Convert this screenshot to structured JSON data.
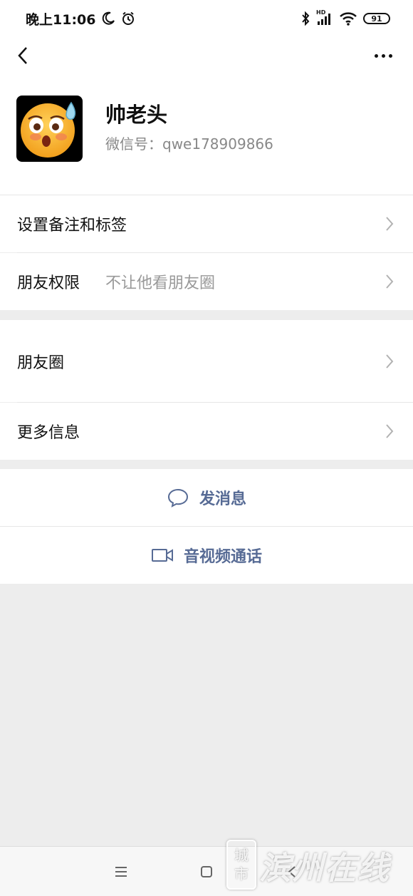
{
  "status_bar": {
    "time": "晚上11:06",
    "moon_icon": "moon-icon",
    "alarm_icon": "alarm-icon",
    "bluetooth_icon": "bluetooth-icon",
    "hd_label": "HD",
    "signal_icon": "signal-icon",
    "wifi_icon": "wifi-icon",
    "battery": "91"
  },
  "nav": {
    "back_icon": "chevron-left-icon",
    "more_icon": "more-horizontal-icon"
  },
  "profile": {
    "name": "帅老头",
    "wechat_id": "微信号：qwe178909866",
    "avatar": "sweat-emoji-avatar"
  },
  "settings": [
    {
      "label": "设置备注和标签",
      "value": ""
    },
    {
      "label": "朋友权限",
      "value": "不让他看朋友圈"
    },
    {
      "label": "朋友圈",
      "value": ""
    },
    {
      "label": "更多信息",
      "value": ""
    }
  ],
  "actions": {
    "message_label": "发消息",
    "call_label": "音视频通话"
  },
  "bottom_nav": {
    "menu_icon": "menu-icon",
    "home_icon": "square-icon",
    "back_icon": "triangle-back-icon"
  },
  "watermark": {
    "badge_top": "城",
    "badge_bottom": "市",
    "text": "滨州在线"
  },
  "colors": {
    "accent_link": "#576b95",
    "background": "#ededed"
  }
}
